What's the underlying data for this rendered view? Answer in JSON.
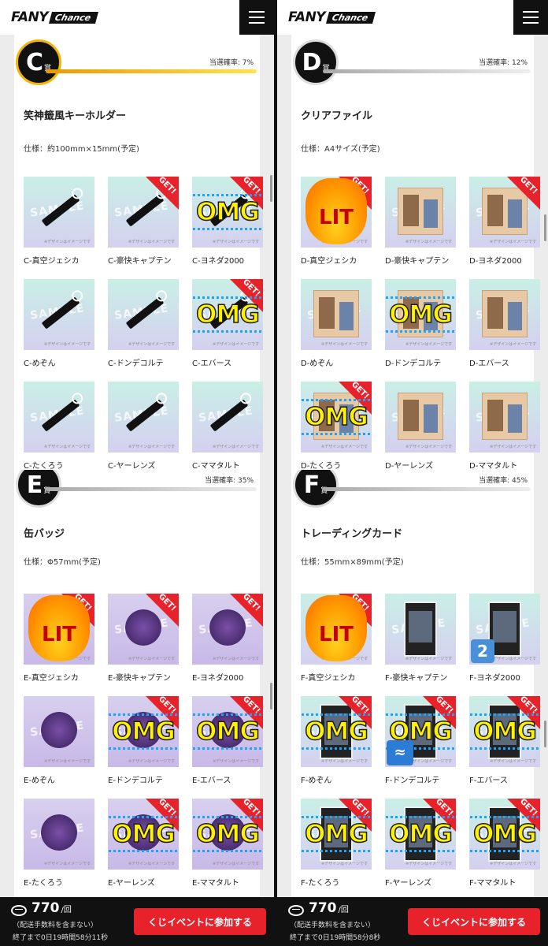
{
  "header": {
    "logo_fany": "FANY",
    "logo_chance": "Chance"
  },
  "panels": [
    {
      "id": "tl",
      "letter": "C",
      "sho": "賞",
      "gold": true,
      "rate_label": "当選確率: 7%",
      "rate_percent": 7,
      "name": "笑神籤風キーホルダー",
      "spec": "仕様：約100mm×15mm(予定)",
      "image": "keyholder",
      "items": [
        {
          "label": "C-真空ジェシカ",
          "get": false,
          "stamp": ""
        },
        {
          "label": "C-豪快キャプテン",
          "get": true,
          "stamp": ""
        },
        {
          "label": "C-ヨネダ2000",
          "get": true,
          "stamp": "OMG"
        },
        {
          "label": "C-めぞん",
          "get": false,
          "stamp": ""
        },
        {
          "label": "C-ドンデコルテ",
          "get": false,
          "stamp": ""
        },
        {
          "label": "C-エバース",
          "get": true,
          "stamp": "OMG"
        },
        {
          "label": "C-たくろう",
          "get": false,
          "stamp": ""
        },
        {
          "label": "C-ヤーレンズ",
          "get": false,
          "stamp": ""
        },
        {
          "label": "C-ママタルト",
          "get": false,
          "stamp": ""
        }
      ]
    },
    {
      "id": "tr",
      "letter": "D",
      "sho": "賞",
      "gold": false,
      "rate_label": "当選確率: 12%",
      "rate_percent": 12,
      "name": "クリアファイル",
      "spec": "仕様：A4サイズ(予定)",
      "image": "file",
      "items": [
        {
          "label": "D-真空ジェシカ",
          "get": true,
          "stamp": "LIT"
        },
        {
          "label": "D-豪快キャプテン",
          "get": false,
          "stamp": ""
        },
        {
          "label": "D-ヨネダ2000",
          "get": true,
          "stamp": ""
        },
        {
          "label": "D-めぞん",
          "get": false,
          "stamp": ""
        },
        {
          "label": "D-ドンデコルテ",
          "get": false,
          "stamp": "OMG"
        },
        {
          "label": "D-エバース",
          "get": false,
          "stamp": ""
        },
        {
          "label": "D-たくろう",
          "get": true,
          "stamp": "OMG"
        },
        {
          "label": "D-ヤーレンズ",
          "get": false,
          "stamp": ""
        },
        {
          "label": "D-ママタルト",
          "get": false,
          "stamp": ""
        }
      ]
    },
    {
      "id": "bl",
      "letter": "E",
      "sho": "賞",
      "gold": false,
      "rate_label": "当選確率: 35%",
      "rate_percent": 35,
      "name": "缶バッジ",
      "spec": "仕様：Φ57mm(予定)",
      "image": "badge",
      "items": [
        {
          "label": "E-真空ジェシカ",
          "get": true,
          "stamp": "LIT"
        },
        {
          "label": "E-豪快キャプテン",
          "get": true,
          "stamp": ""
        },
        {
          "label": "E-ヨネダ2000",
          "get": true,
          "stamp": ""
        },
        {
          "label": "E-めぞん",
          "get": false,
          "stamp": ""
        },
        {
          "label": "E-ドンデコルテ",
          "get": true,
          "stamp": "OMG"
        },
        {
          "label": "E-エバース",
          "get": true,
          "stamp": "OMG"
        },
        {
          "label": "E-たくろう",
          "get": false,
          "stamp": ""
        },
        {
          "label": "E-ヤーレンズ",
          "get": true,
          "stamp": "OMG"
        },
        {
          "label": "E-ママタルト",
          "get": true,
          "stamp": "OMG"
        }
      ]
    },
    {
      "id": "br",
      "letter": "F",
      "sho": "賞",
      "gold": false,
      "rate_label": "当選確率: 45%",
      "rate_percent": 45,
      "name": "トレーディングカード",
      "spec": "仕様：55mm×89mm(予定)",
      "image": "card",
      "items": [
        {
          "label": "F-真空ジェシカ",
          "get": true,
          "stamp": "LIT"
        },
        {
          "label": "F-豪快キャプテン",
          "get": false,
          "stamp": ""
        },
        {
          "label": "F-ヨネダ2000",
          "get": false,
          "stamp": "2"
        },
        {
          "label": "F-めぞん",
          "get": true,
          "stamp": "OMG"
        },
        {
          "label": "F-ドンデコルテ",
          "get": true,
          "stamp": "OMG+wave"
        },
        {
          "label": "F-エバース",
          "get": true,
          "stamp": "OMG"
        },
        {
          "label": "F-たくろう",
          "get": true,
          "stamp": "OMG"
        },
        {
          "label": "F-ヤーレンズ",
          "get": true,
          "stamp": "OMG"
        },
        {
          "label": "F-ママタルト",
          "get": true,
          "stamp": "OMG"
        }
      ]
    }
  ],
  "common": {
    "get_label": "GET!",
    "sample_text": "SAMPLE",
    "design_note": "※デザインはイメージです"
  },
  "bottom": [
    {
      "price": "770",
      "per": "/回",
      "shipping": "（配送手数料を含まない）",
      "countdown": "終了まで0日19時間58分11秒",
      "button": "くじイベントに参加する"
    },
    {
      "price": "770",
      "per": "/回",
      "shipping": "（配送手数料を含まない）",
      "countdown": "終了まで0日19時間58分8秒",
      "button": "くじイベントに参加する"
    }
  ],
  "colors": {
    "accent_red": "#e8222b",
    "gold": "#f2b705",
    "omg_yellow": "#fff100"
  }
}
